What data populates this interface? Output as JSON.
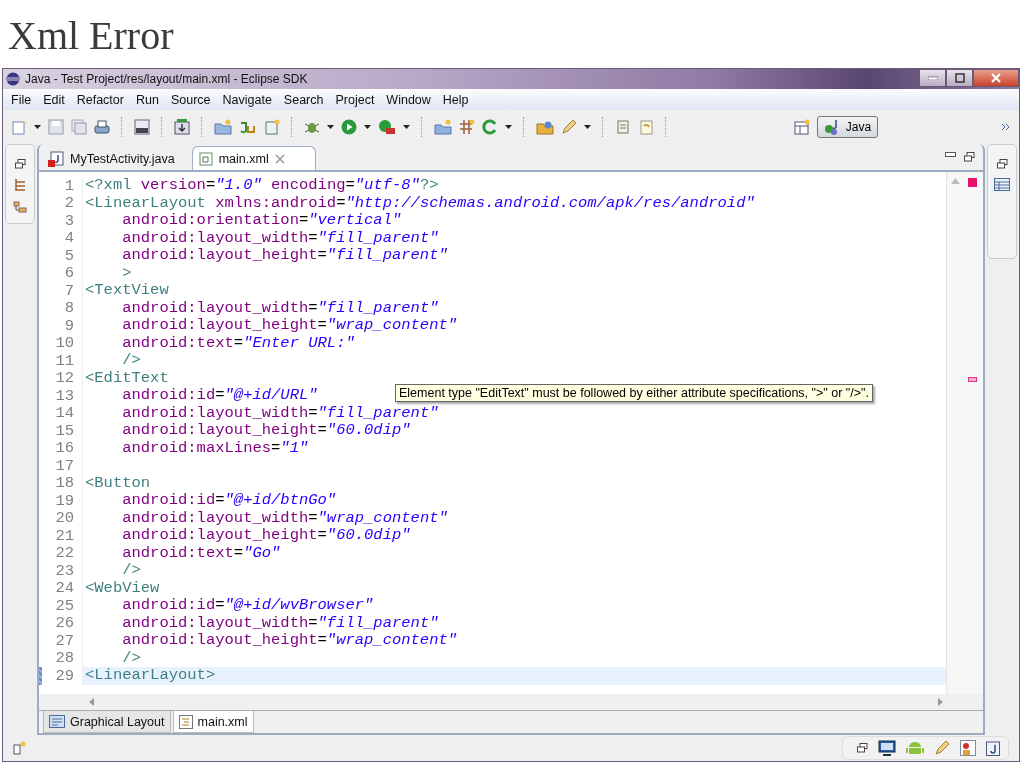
{
  "slide_title": "Xml Error",
  "window": {
    "title": "Java - Test Project/res/layout/main.xml - Eclipse SDK"
  },
  "menu": [
    "File",
    "Edit",
    "Refactor",
    "Run",
    "Source",
    "Navigate",
    "Search",
    "Project",
    "Window",
    "Help"
  ],
  "perspective": {
    "label": "Java",
    "selected": true
  },
  "editor_tabs": [
    {
      "label": "MyTestActivity.java",
      "selected": false
    },
    {
      "label": "main.xml",
      "selected": true
    }
  ],
  "code_lines": [
    {
      "number": "1",
      "selected": false,
      "segments": [
        {
          "kind": "tag",
          "text": "<?xml "
        },
        {
          "kind": "attr",
          "text": "version"
        },
        {
          "kind": "punct",
          "text": "="
        },
        {
          "kind": "value",
          "text": "\"1.0\""
        },
        {
          "kind": "attr",
          "text": " encoding"
        },
        {
          "kind": "punct",
          "text": "="
        },
        {
          "kind": "value",
          "text": "\"utf-8\""
        },
        {
          "kind": "tag",
          "text": "?>"
        }
      ]
    },
    {
      "number": "2",
      "selected": false,
      "segments": [
        {
          "kind": "tag",
          "text": "<LinearLayout "
        },
        {
          "kind": "attr",
          "text": "xmlns:android"
        },
        {
          "kind": "punct",
          "text": "="
        },
        {
          "kind": "value",
          "text": "\"http://schemas.android.com/apk/res/android\""
        }
      ]
    },
    {
      "number": "3",
      "selected": false,
      "segments": [
        {
          "kind": "attr",
          "text": "    android:orientation"
        },
        {
          "kind": "punct",
          "text": "="
        },
        {
          "kind": "value",
          "text": "\"vertical\""
        }
      ]
    },
    {
      "number": "4",
      "selected": false,
      "segments": [
        {
          "kind": "attr",
          "text": "    android:layout_width"
        },
        {
          "kind": "punct",
          "text": "="
        },
        {
          "kind": "value",
          "text": "\"fill_parent\""
        }
      ]
    },
    {
      "number": "5",
      "selected": false,
      "segments": [
        {
          "kind": "attr",
          "text": "    android:layout_height"
        },
        {
          "kind": "punct",
          "text": "="
        },
        {
          "kind": "value",
          "text": "\"fill_parent\""
        }
      ]
    },
    {
      "number": "6",
      "selected": false,
      "segments": [
        {
          "kind": "tag",
          "text": "    >"
        }
      ]
    },
    {
      "number": "7",
      "selected": false,
      "segments": [
        {
          "kind": "tag",
          "text": "<TextView"
        }
      ]
    },
    {
      "number": "8",
      "selected": false,
      "segments": [
        {
          "kind": "attr",
          "text": "    android:layout_width"
        },
        {
          "kind": "punct",
          "text": "="
        },
        {
          "kind": "value",
          "text": "\"fill_parent\""
        }
      ]
    },
    {
      "number": "9",
      "selected": false,
      "segments": [
        {
          "kind": "attr",
          "text": "    android:layout_height"
        },
        {
          "kind": "punct",
          "text": "="
        },
        {
          "kind": "value",
          "text": "\"wrap_content\""
        }
      ]
    },
    {
      "number": "10",
      "selected": false,
      "segments": [
        {
          "kind": "attr",
          "text": "    android:text"
        },
        {
          "kind": "punct",
          "text": "="
        },
        {
          "kind": "value",
          "text": "\"Enter URL:\""
        }
      ]
    },
    {
      "number": "11",
      "selected": false,
      "segments": [
        {
          "kind": "tag",
          "text": "    />"
        }
      ]
    },
    {
      "number": "12",
      "selected": false,
      "segments": [
        {
          "kind": "tag",
          "text": "<EditText"
        }
      ]
    },
    {
      "number": "13",
      "selected": false,
      "segments": [
        {
          "kind": "attr",
          "text": "    android:id"
        },
        {
          "kind": "punct",
          "text": "="
        },
        {
          "kind": "value",
          "text": "\"@+id/URL\""
        }
      ]
    },
    {
      "number": "14",
      "selected": false,
      "segments": [
        {
          "kind": "attr",
          "text": "    android:layout_width"
        },
        {
          "kind": "punct",
          "text": "="
        },
        {
          "kind": "value",
          "text": "\"fill_parent\""
        }
      ]
    },
    {
      "number": "15",
      "selected": false,
      "segments": [
        {
          "kind": "attr",
          "text": "    android:layout_height"
        },
        {
          "kind": "punct",
          "text": "="
        },
        {
          "kind": "value",
          "text": "\"60.0dip\""
        }
      ]
    },
    {
      "number": "16",
      "selected": false,
      "segments": [
        {
          "kind": "attr",
          "text": "    android:maxLines"
        },
        {
          "kind": "punct",
          "text": "="
        },
        {
          "kind": "value",
          "text": "\"1\""
        }
      ]
    },
    {
      "number": "17",
      "selected": false
    },
    {
      "number": "18",
      "selected": false,
      "segments": [
        {
          "kind": "tag",
          "text": "<Button"
        }
      ]
    },
    {
      "number": "19",
      "selected": false,
      "segments": [
        {
          "kind": "attr",
          "text": "    android:id"
        },
        {
          "kind": "punct",
          "text": "="
        },
        {
          "kind": "value",
          "text": "\"@+id/btnGo\""
        }
      ]
    },
    {
      "number": "20",
      "selected": false,
      "segments": [
        {
          "kind": "attr",
          "text": "    android:layout_width"
        },
        {
          "kind": "punct",
          "text": "="
        },
        {
          "kind": "value",
          "text": "\"wrap_content\""
        }
      ]
    },
    {
      "number": "21",
      "selected": false,
      "segments": [
        {
          "kind": "attr",
          "text": "    android:layout_height"
        },
        {
          "kind": "punct",
          "text": "="
        },
        {
          "kind": "value",
          "text": "\"60.0dip\""
        }
      ]
    },
    {
      "number": "22",
      "selected": false,
      "segments": [
        {
          "kind": "attr",
          "text": "    android:text"
        },
        {
          "kind": "punct",
          "text": "="
        },
        {
          "kind": "value",
          "text": "\"Go\""
        }
      ]
    },
    {
      "number": "23",
      "selected": false,
      "segments": [
        {
          "kind": "tag",
          "text": "    />"
        }
      ]
    },
    {
      "number": "24",
      "selected": false,
      "segments": [
        {
          "kind": "tag",
          "text": "<WebView"
        }
      ]
    },
    {
      "number": "25",
      "selected": false,
      "segments": [
        {
          "kind": "attr",
          "text": "    android:id"
        },
        {
          "kind": "punct",
          "text": "="
        },
        {
          "kind": "value",
          "text": "\"@+id/wvBrowser\""
        }
      ]
    },
    {
      "number": "26",
      "selected": false,
      "segments": [
        {
          "kind": "attr",
          "text": "    android:layout_width"
        },
        {
          "kind": "punct",
          "text": "="
        },
        {
          "kind": "value",
          "text": "\"fill_parent\""
        }
      ]
    },
    {
      "number": "27",
      "selected": false,
      "segments": [
        {
          "kind": "attr",
          "text": "    android:layout_height"
        },
        {
          "kind": "punct",
          "text": "="
        },
        {
          "kind": "value",
          "text": "\"wrap_content\""
        }
      ]
    },
    {
      "number": "28",
      "selected": false,
      "segments": [
        {
          "kind": "tag",
          "text": "    />"
        }
      ]
    },
    {
      "number": "29",
      "selected": true,
      "segments": [
        {
          "kind": "tag",
          "text": "<LinearLayout>"
        }
      ]
    }
  ],
  "tooltip": "Element type \"EditText\" must be followed by either attribute specifications, \">\" or \"/>\".",
  "bottom_tabs": [
    {
      "label": "Graphical Layout",
      "selected": false
    },
    {
      "label": "main.xml",
      "selected": true
    }
  ]
}
